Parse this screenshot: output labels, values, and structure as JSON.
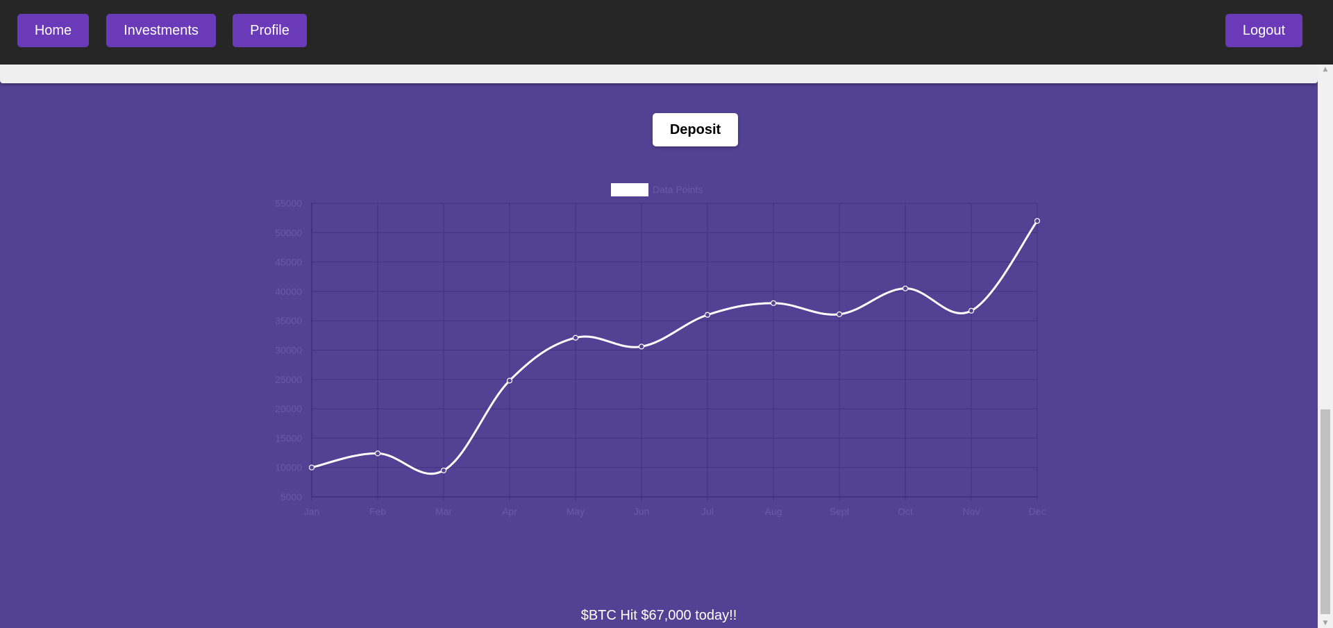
{
  "nav": {
    "home_label": "Home",
    "investments_label": "Investments",
    "profile_label": "Profile",
    "logout_label": "Logout"
  },
  "deposit_label": "Deposit",
  "headline": "$BTC Hit $67,000 today!!",
  "colors": {
    "page_background": "#524293",
    "topbar": "#262626",
    "nav_button": "#6a3ab8",
    "line": "#ffffff",
    "grid": "#3f3380",
    "tick_label": "#6a5aa5"
  },
  "chart_data": {
    "type": "line",
    "categories": [
      "Jan",
      "Feb",
      "Mar",
      "Apr",
      "May",
      "Jun",
      "Jul",
      "Aug",
      "Sept",
      "Oct",
      "Nov",
      "Dec"
    ],
    "series": [
      {
        "name": "Data Points",
        "values": [
          10000,
          12400,
          9500,
          24800,
          32100,
          30600,
          36000,
          38000,
          36100,
          40500,
          36700,
          52000
        ]
      }
    ],
    "yticks": [
      55000,
      50000,
      45000,
      40000,
      35000,
      30000,
      25000,
      20000,
      15000,
      10000,
      5000
    ],
    "ylim": [
      5000,
      55000
    ],
    "grid": true,
    "legend_position": "top-center"
  }
}
